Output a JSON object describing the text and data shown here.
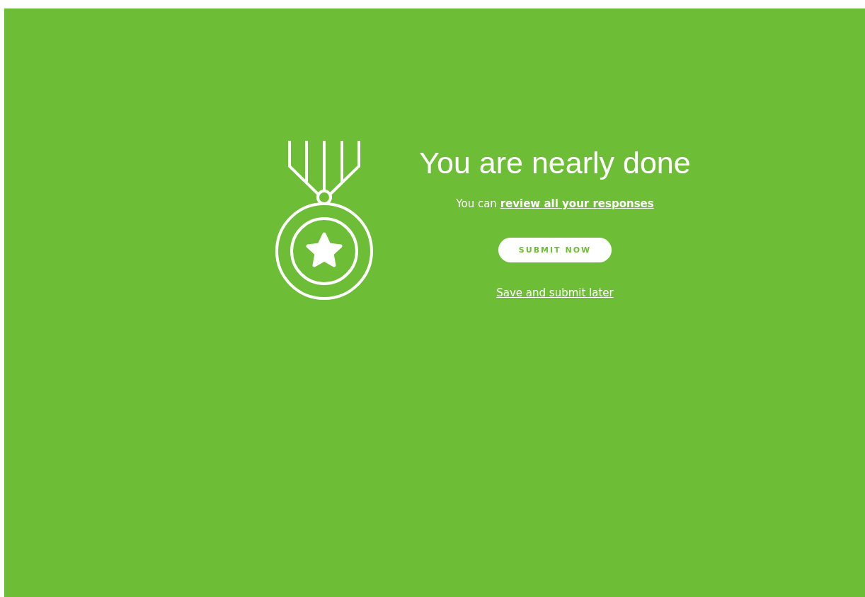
{
  "heading": "You are nearly done",
  "message": {
    "text": "You can",
    "link": "review all your responses"
  },
  "primary_button": "SUBMIT NOW",
  "secondary_link": "Save and submit later"
}
